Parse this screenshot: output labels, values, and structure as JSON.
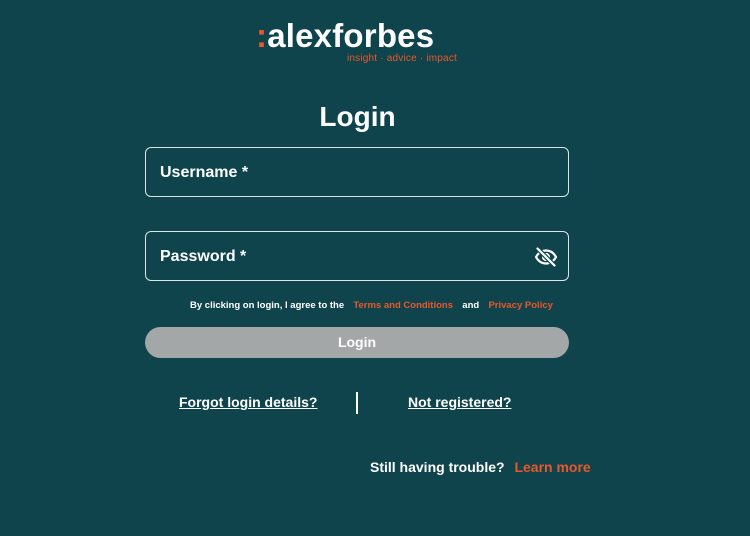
{
  "brand": {
    "colon": ":",
    "name": "alexforbes",
    "tagline": "insight · advice · impact"
  },
  "page": {
    "title": "Login"
  },
  "form": {
    "username_label": "Username *",
    "username_value": "",
    "password_label": "Password *",
    "password_value": "",
    "password_toggle_icon": "eye-off-icon",
    "consent_prefix": "By clicking on login, I agree to the",
    "terms_link": "Terms and Conditions",
    "consent_and": "and",
    "privacy_link": "Privacy Policy",
    "login_label": "Login"
  },
  "links": {
    "forgot": "Forgot login details?",
    "register": "Not registered?"
  },
  "help": {
    "prompt": "Still having trouble?",
    "learn_more": "Learn more"
  },
  "colors": {
    "background": "#0f444d",
    "accent": "#e8582a",
    "button_disabled": "#a4a7a8"
  }
}
